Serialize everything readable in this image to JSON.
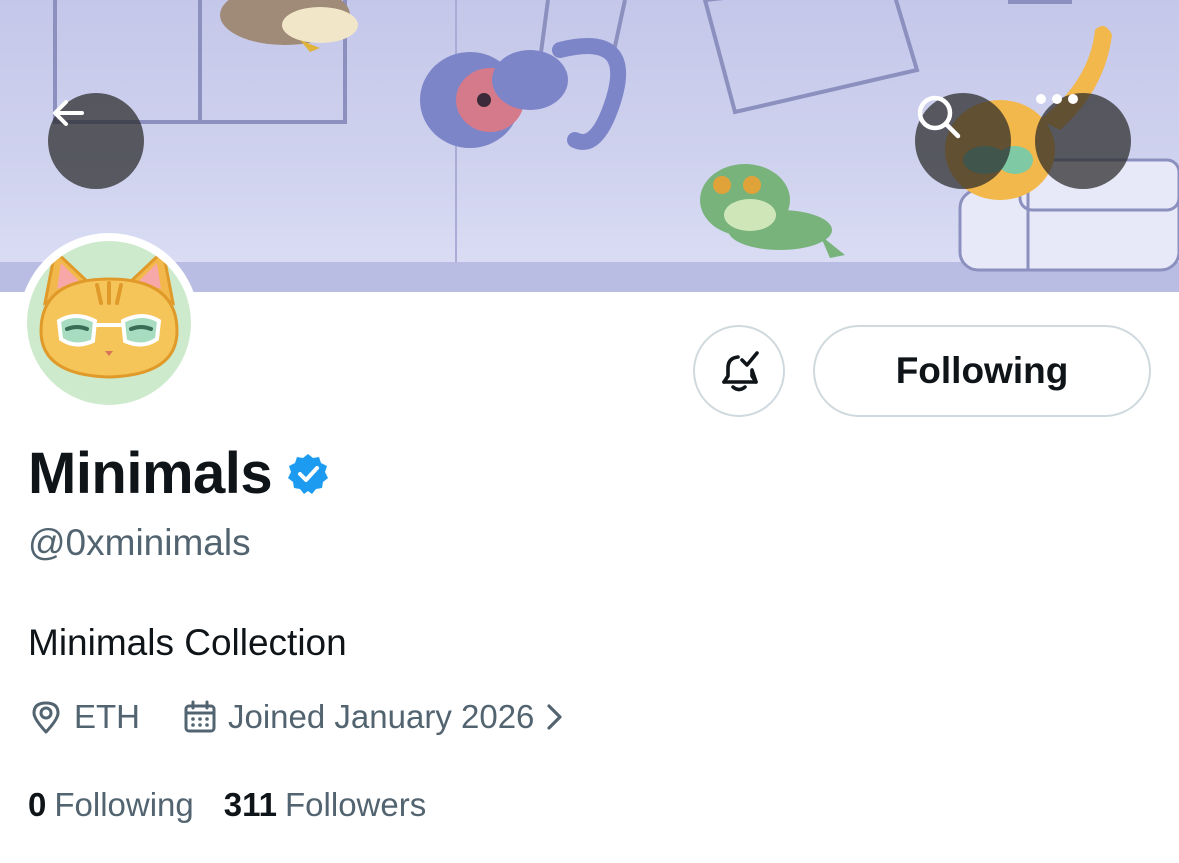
{
  "profile": {
    "display_name": "Minimals",
    "handle": "@0xminimals",
    "bio": "Minimals Collection",
    "location": "ETH",
    "joined": "Joined January 2026",
    "verified": true
  },
  "actions": {
    "following_label": "Following"
  },
  "stats": {
    "following_count": "0",
    "following_label": "Following",
    "followers_count": "311",
    "followers_label": "Followers"
  },
  "icons": {
    "back": "arrow-left-icon",
    "search": "search-icon",
    "more": "more-horizontal-icon",
    "notify": "bell-check-icon",
    "verified": "verified-badge-icon",
    "location": "location-pin-icon",
    "calendar": "calendar-icon",
    "chevron": "chevron-right-icon"
  },
  "colors": {
    "verified_blue": "#1d9bf0",
    "text_primary": "#0f1419",
    "text_secondary": "#536471",
    "border": "#cfd9de",
    "banner_bg": "#cfd2ee",
    "avatar_bg": "#cdeacc"
  }
}
